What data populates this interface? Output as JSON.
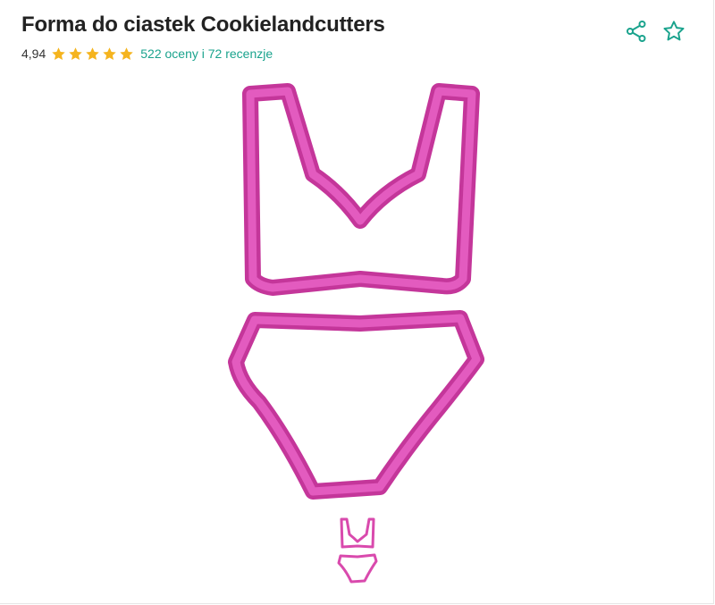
{
  "product": {
    "title": "Forma do ciastek Cookielandcutters",
    "rating_value": "4,94",
    "rating_stars": 5,
    "reviews_text": "522 oceny i 72 recenzje"
  },
  "actions": {
    "share_icon": "share-icon",
    "favorite_icon": "star-outline-icon"
  },
  "colors": {
    "accent": "#1aa38d",
    "star": "#f5b41e",
    "cutter_pink": "#d94aad"
  },
  "image": {
    "subject": "bikini-shaped-cookie-cutters"
  }
}
